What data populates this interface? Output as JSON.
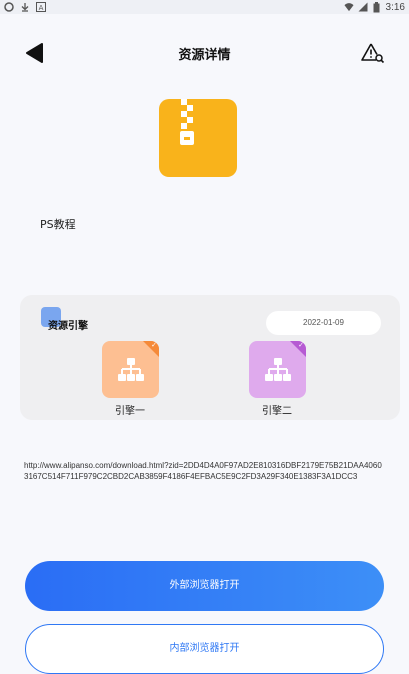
{
  "status_bar": {
    "time": "3:16",
    "left_icons": [
      "app-circle-icon",
      "download-icon",
      "text-a-icon"
    ],
    "right_icons": [
      "wifi-icon",
      "signal-icon",
      "battery-icon"
    ]
  },
  "header": {
    "title": "资源详情",
    "back_icon": "back-triangle-icon",
    "report_icon": "warning-search-icon"
  },
  "resource": {
    "icon": "zip-archive-icon",
    "name": "PS教程",
    "url": "http://www.alipanso.com/download.html?zid=2DD4D4A0F97AD2E810316DBF2179E75B21DAA40603167C514F711F979C2CBD2CAB3859F4186F4EFBAC5E9C2FD3A29F340E1383F3A1DCC3"
  },
  "engines": {
    "title": "资源引擎",
    "date": "2022-01-09",
    "items": [
      {
        "label": "引擎一",
        "color": "#fdbf92",
        "icon": "network-icon",
        "selected": true
      },
      {
        "label": "引擎二",
        "color": "#dfaaed",
        "icon": "network-icon",
        "selected": true
      }
    ]
  },
  "actions": {
    "external_label": "外部浏览器打开",
    "internal_label": "内部浏览器打开"
  },
  "colors": {
    "accent": "#2f78f4",
    "archive": "#f9b31b"
  }
}
